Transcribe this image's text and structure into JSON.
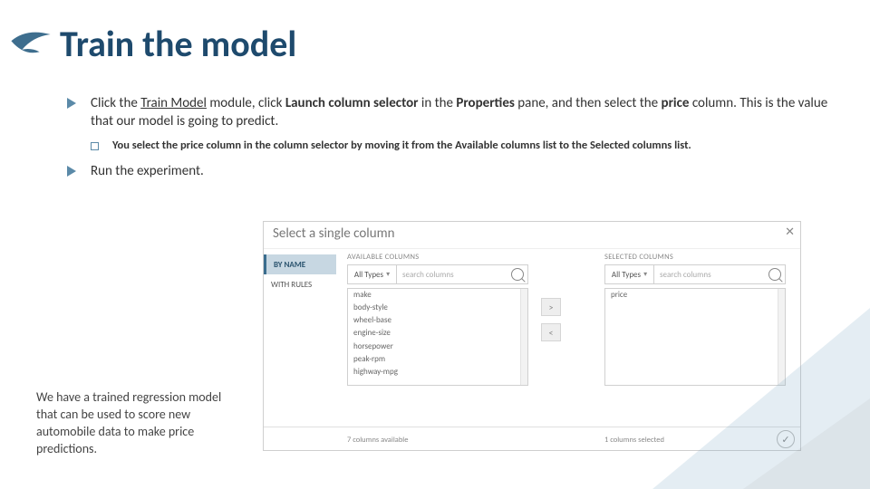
{
  "title": "Train the model",
  "bullets": {
    "b1_before_link": "Click the ",
    "b1_link": "Train Model",
    "b1_after_link": " module, click ",
    "b1_bold1": "Launch column selector",
    "b1_mid": " in the ",
    "b1_bold2": "Properties",
    "b1_after_bold2": " pane, and then select the ",
    "b1_bold3": "price",
    "b1_tail": " column. This is the value that our model is going to predict.",
    "b1_sub_prefix": "You select the ",
    "b1_sub_bold1": "price",
    "b1_sub_mid1": " column in the column selector by moving it from the ",
    "b1_sub_bold2": "Available columns",
    "b1_sub_mid2": " list to the ",
    "b1_sub_bold3": "Selected columns",
    "b1_sub_tail": " list.",
    "b2": "Run the experiment."
  },
  "dialog": {
    "title": "Select a single column",
    "left": {
      "by_name": "BY NAME",
      "with_rules": "WITH RULES"
    },
    "available": {
      "label": "AVAILABLE COLUMNS",
      "type": "All Types",
      "search_ph": "search columns",
      "items": [
        "make",
        "body-style",
        "wheel-base",
        "engine-size",
        "horsepower",
        "peak-rpm",
        "highway-mpg"
      ],
      "footer": "7 columns available"
    },
    "selected": {
      "label": "SELECTED COLUMNS",
      "type": "All Types",
      "search_ph": "search columns",
      "items": [
        "price"
      ],
      "footer": "1 columns selected"
    },
    "move_right": ">",
    "move_left": "<",
    "ok": "✓"
  },
  "caption": "We have a trained regression model that can be used to score new automobile data to make price predictions."
}
